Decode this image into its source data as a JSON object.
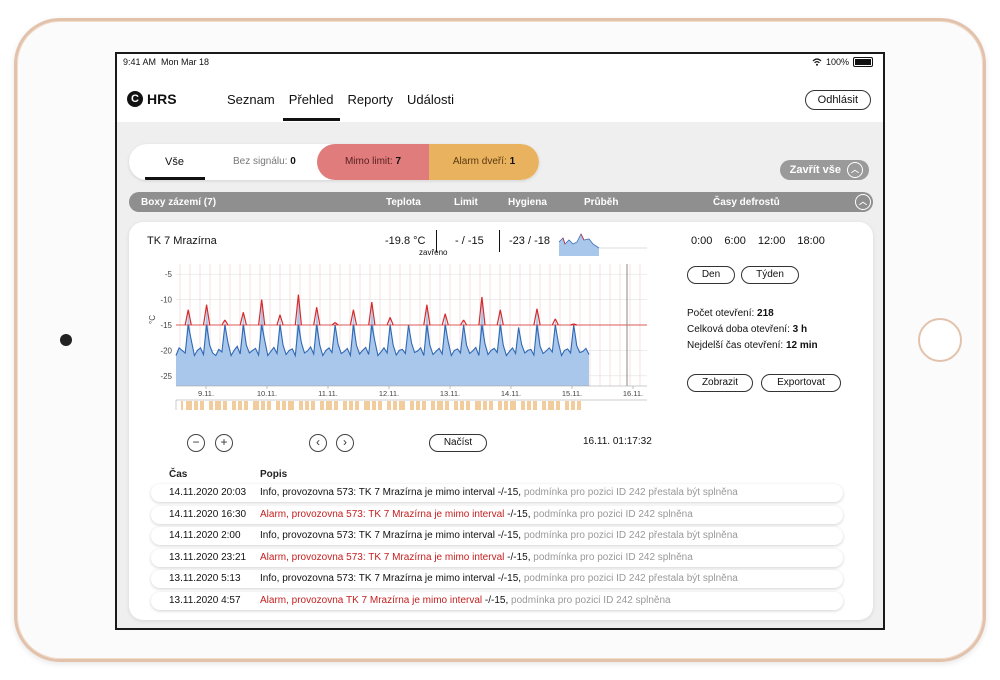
{
  "status_bar": {
    "time": "9:41 AM",
    "date": "Mon Mar 18",
    "battery": "100%"
  },
  "app": {
    "logo": "HRS",
    "logo_mark": "C"
  },
  "nav": {
    "tabs": [
      "Seznam",
      "Přehled",
      "Reporty",
      "Události"
    ],
    "active": "Přehled",
    "logout": "Odhlásit"
  },
  "filters": {
    "all": "Vše",
    "no_signal_label": "Bez signálu:",
    "no_signal_count": "0",
    "out_limit_label": "Mimo limit:",
    "out_limit_count": "7",
    "door_alarm_label": "Alarm dveří:",
    "door_alarm_count": "1",
    "close_all": "Zavřít vše"
  },
  "group": {
    "title": "Boxy zázemí (7)",
    "columns": [
      "Teplota",
      "Limit",
      "Hygiena",
      "Průběh",
      "Časy defrostů"
    ]
  },
  "device": {
    "name": "TK 7 Mrazírna",
    "temperature": "-19.8 °C",
    "door_state": "zavřeno",
    "limit": "- / -15",
    "hygiene": "-23 / -18",
    "defrost_times": [
      "0:00",
      "6:00",
      "12:00",
      "18:00"
    ],
    "range_buttons": [
      "Den",
      "Týden"
    ],
    "stats": {
      "openings_label": "Počet otevření:",
      "openings_value": "218",
      "total_open_label": "Celková doba otevření:",
      "total_open_value": "3 h",
      "longest_open_label": "Nejdelší čas otevření:",
      "longest_open_value": "12 min"
    },
    "actions": {
      "show": "Zobrazit",
      "export": "Exportovat"
    },
    "controls": {
      "zoom_out": "−",
      "zoom_in": "+",
      "prev": "‹",
      "next": "›",
      "load": "Načíst"
    },
    "timestamp": "16.11. 01:17:32"
  },
  "chart_data": {
    "type": "area",
    "ylabel": "°C",
    "yticks": [
      -5,
      -10,
      -15,
      -20,
      -25
    ],
    "ylim": [
      -27,
      -3
    ],
    "xticks": [
      "9.11.",
      "10.11.",
      "11.11.",
      "12.11.",
      "13.11.",
      "14.11.",
      "15.11.",
      "16.11."
    ],
    "limit_line": -15,
    "grid": true,
    "series": [
      {
        "values": [
          -21,
          -19.5,
          -20,
          -20.5,
          -12,
          -18,
          -21,
          -20,
          -19.5,
          -20.8,
          -11,
          -19,
          -20.5,
          -21,
          -19.8,
          -20.3,
          -14,
          -18.5,
          -21,
          -20,
          -19.2,
          -20.7,
          -12.5,
          -19,
          -20.5,
          -20,
          -19.6,
          -20.9,
          -10,
          -18,
          -21,
          -20.2,
          -19.4,
          -20.6,
          -13,
          -19,
          -20.8,
          -20,
          -19.7,
          -21,
          -9,
          -18.5,
          -20.5,
          -20.1,
          -19.3,
          -20.7,
          -11.5,
          -19,
          -21,
          -20,
          -19.5,
          -20.4,
          -14.5,
          -18.8,
          -20.6,
          -20.2,
          -19.6,
          -21,
          -12,
          -19,
          -20.7,
          -20,
          -19.4,
          -20.8,
          -10.5,
          -18.2,
          -21,
          -20.3,
          -19.5,
          -20.5,
          -13.5,
          -19,
          -20.9,
          -20,
          -19.8,
          -20.6,
          -15,
          -18.6,
          -20.4,
          -20.1,
          -19.5,
          -21,
          -11,
          -19,
          -20.8,
          -20.2,
          -19.6,
          -20.7,
          -12.8,
          -18.4,
          -21,
          -20,
          -19.7,
          -20.5,
          -14,
          -19,
          -20.6,
          -20.1,
          -19.4,
          -21,
          -9.5,
          -18.7,
          -20.8,
          -20,
          -19.6,
          -20.4,
          -12,
          -19,
          -21,
          -20.2,
          -19.5,
          -20.6,
          -15.5,
          -18.9,
          -20.5,
          -20,
          -19.8,
          -20.9,
          -11.8,
          -19.2,
          -20.6,
          -20.1,
          -19.5,
          -20.3,
          -13.8,
          -18.5,
          -21,
          -20,
          -19.7,
          -20.5,
          -14.8,
          -19.1,
          -20.4,
          -20.2,
          -19.6,
          -20.8
        ]
      }
    ]
  },
  "events": {
    "col_time": "Čas",
    "col_desc": "Popis",
    "rows": [
      {
        "time": "14.11.2020 20:03",
        "severity": "info",
        "head": "Info, provozovna  573: TK 7 Mrazírna je mimo interval ",
        "mid": "-/-15, ",
        "tail": "podmínka pro pozici ID 242 přestala být splněna"
      },
      {
        "time": "14.11.2020 16:30",
        "severity": "alarm",
        "head": "Alarm, provozovna  573: TK 7 Mrazírna je mimo interval ",
        "mid": "-/-15, ",
        "tail": "podmínka pro pozici ID 242 splněna"
      },
      {
        "time": "14.11.2020 2:00",
        "severity": "info",
        "head": "Info, provozovna  573: TK 7 Mrazírna je mimo interval ",
        "mid": "-/-15, ",
        "tail": "podmínka pro pozici ID 242 přestala být splněna"
      },
      {
        "time": "13.11.2020 23:21",
        "severity": "alarm",
        "head": "Alarm, provozovna  573: TK 7 Mrazírna je mimo interval ",
        "mid": "-/-15, ",
        "tail": "podmínka pro pozici ID 242 splněna"
      },
      {
        "time": "13.11.2020 5:13",
        "severity": "info",
        "head": "Info, provozovna  573: TK 7 Mrazírna je mimo interval ",
        "mid": "-/-15, ",
        "tail": "podmínka pro pozici ID 242 přestala být splněna"
      },
      {
        "time": "13.11.2020 4:57",
        "severity": "alarm",
        "head": "Alarm, provozovna TK 7 Mrazírna je mimo interval ",
        "mid": "-/-15, ",
        "tail": "podmínka pro pozici ID 242 splněna"
      }
    ]
  }
}
